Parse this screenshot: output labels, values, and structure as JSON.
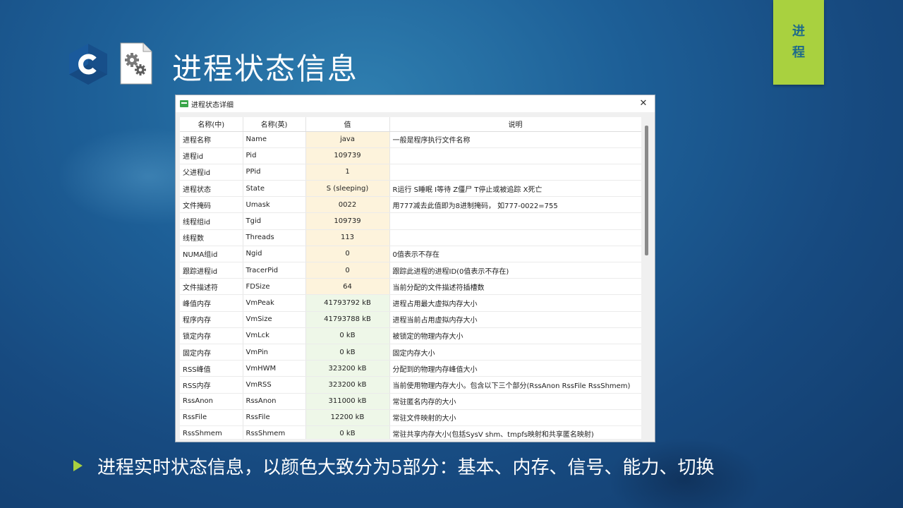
{
  "slide": {
    "title": "进程状态信息",
    "section_tab": [
      "进",
      "程"
    ],
    "bullet": "进程实时状态信息，以颜色大致分为5部分：基本、内存、信号、能力、切换",
    "logo_icon": "c-language-logo-icon",
    "file_icon": "settings-file-icon",
    "colors": {
      "tab": "#a9d13f",
      "basic_value": "#fdf3dc",
      "memory_value": "#eef7e8"
    }
  },
  "window": {
    "title": "进程状态详细",
    "close_label": "✕",
    "columns": [
      "名称(中)",
      "名称(英)",
      "值",
      "说明"
    ],
    "rows": [
      {
        "cn": "进程名称",
        "en": "Name",
        "value": "java",
        "desc": "一般是程序执行文件名称",
        "group": "basic"
      },
      {
        "cn": "进程id",
        "en": "Pid",
        "value": "109739",
        "desc": "",
        "group": "basic"
      },
      {
        "cn": "父进程id",
        "en": "PPid",
        "value": "1",
        "desc": "",
        "group": "basic"
      },
      {
        "cn": "进程状态",
        "en": "State",
        "value": "S (sleeping)",
        "desc": "R运行 S睡眠 I等待 Z僵尸 T停止或被追踪 X死亡",
        "group": "basic"
      },
      {
        "cn": "文件掩码",
        "en": "Umask",
        "value": "0022",
        "desc": "用777减去此值即为8进制掩码， 如777-0022=755",
        "group": "basic"
      },
      {
        "cn": "线程组id",
        "en": "Tgid",
        "value": "109739",
        "desc": "",
        "group": "basic"
      },
      {
        "cn": "线程数",
        "en": "Threads",
        "value": "113",
        "desc": "",
        "group": "basic"
      },
      {
        "cn": "NUMA组id",
        "en": "Ngid",
        "value": "0",
        "desc": "0值表示不存在",
        "group": "basic"
      },
      {
        "cn": "跟踪进程id",
        "en": "TracerPid",
        "value": "0",
        "desc": "跟踪此进程的进程ID(0值表示不存在)",
        "group": "basic"
      },
      {
        "cn": "文件描述符",
        "en": "FDSize",
        "value": "64",
        "desc": "当前分配的文件描述符插槽数",
        "group": "basic"
      },
      {
        "cn": "峰值内存",
        "en": "VmPeak",
        "value": "41793792 kB",
        "desc": "进程占用最大虚拟内存大小",
        "group": "mem"
      },
      {
        "cn": "程序内存",
        "en": "VmSize",
        "value": "41793788 kB",
        "desc": "进程当前占用虚拟内存大小",
        "group": "mem"
      },
      {
        "cn": "锁定内存",
        "en": "VmLck",
        "value": "0 kB",
        "desc": "被锁定的物理内存大小",
        "group": "mem"
      },
      {
        "cn": "固定内存",
        "en": "VmPin",
        "value": "0 kB",
        "desc": "固定内存大小",
        "group": "mem"
      },
      {
        "cn": "RSS峰值",
        "en": "VmHWM",
        "value": "323200 kB",
        "desc": "分配到的物理内存峰值大小",
        "group": "mem"
      },
      {
        "cn": "RSS内存",
        "en": "VmRSS",
        "value": "323200 kB",
        "desc": "当前使用物理内存大小。包含以下三个部分(RssAnon RssFile RssShmem)",
        "group": "mem"
      },
      {
        "cn": "RssAnon",
        "en": "RssAnon",
        "value": "311000 kB",
        "desc": "常驻匿名内存的大小",
        "group": "mem"
      },
      {
        "cn": "RssFile",
        "en": "RssFile",
        "value": "12200 kB",
        "desc": "常驻文件映射的大小",
        "group": "mem"
      },
      {
        "cn": "RssShmem",
        "en": "RssShmem",
        "value": "0 kB",
        "desc": "常驻共享内存大小(包括SysV shm、tmpfs映射和共享匿名映射)",
        "group": "mem"
      }
    ]
  }
}
